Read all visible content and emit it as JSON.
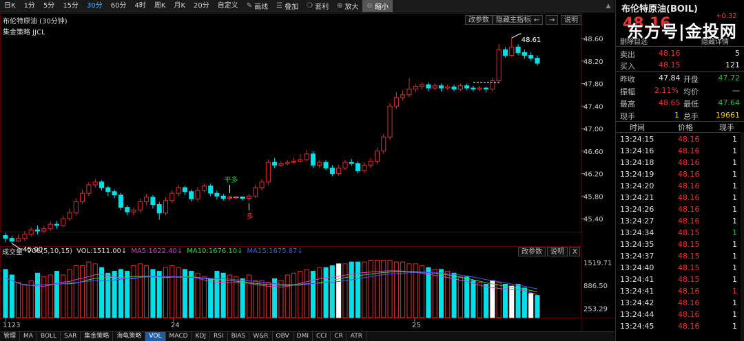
{
  "toolbar": {
    "timeframes": [
      {
        "label": "日K",
        "active": false
      },
      {
        "label": "1分",
        "active": false
      },
      {
        "label": "5分",
        "active": false
      },
      {
        "label": "15分",
        "active": false
      },
      {
        "label": "30分",
        "active": true
      },
      {
        "label": "60分",
        "active": false
      },
      {
        "label": "4时",
        "active": false
      },
      {
        "label": "周K",
        "active": false
      },
      {
        "label": "月K",
        "active": false
      },
      {
        "label": "20分",
        "active": false
      },
      {
        "label": "自定义",
        "active": false
      }
    ],
    "tools": [
      {
        "label": "画线",
        "icon": "pencil-icon",
        "glyph": "✎",
        "active": false
      },
      {
        "label": "叠加",
        "icon": "stack-icon",
        "glyph": "☰",
        "active": false
      },
      {
        "label": "套利",
        "icon": "money-bag-icon",
        "glyph": "❍",
        "active": false
      },
      {
        "label": "放大",
        "icon": "zoom-in-icon",
        "glyph": "⊕",
        "active": false
      },
      {
        "label": "缩小",
        "icon": "zoom-out-icon",
        "glyph": "⊖",
        "active": true
      }
    ],
    "scroll_up_icon": "▲"
  },
  "chart": {
    "title": "布伦特原油 (30分钟)",
    "strategy": "集金策略 JJCL",
    "buttons": {
      "params": "改参数",
      "hide": "隐藏主指标",
      "left": "←",
      "right": "→",
      "help": "说明"
    },
    "price_axis": [
      "48.60",
      "48.20",
      "47.80",
      "47.40",
      "47.00",
      "46.60",
      "46.20",
      "45.80",
      "45.40"
    ],
    "annotations": {
      "high_label": "48.61",
      "low_label": "45.00",
      "signal_flat": "平多",
      "signal_long": "多"
    },
    "x_axis": [
      "1123",
      "24",
      "25"
    ],
    "colors": {
      "up": "#e03030",
      "down": "#00e0e8",
      "ma5": "#e03cd6",
      "ma10": "#34d34a",
      "ma15": "#4a56ff"
    }
  },
  "volume": {
    "title": "成交量",
    "params": "VOL(5,10,15)",
    "vol": "VOL:1511.00↓",
    "ma5": "MA5:1622.40↓",
    "ma10": "MA10:1676.10↓",
    "ma15": "MA15:1675.87↓",
    "axis": [
      "1519.71",
      "886.50",
      "253.29"
    ],
    "buttons": {
      "params": "改参数",
      "help": "说明",
      "close": "X"
    }
  },
  "bottom_tabs": [
    {
      "label": "管理",
      "active": false
    },
    {
      "label": "MA",
      "active": false
    },
    {
      "label": "BOLL",
      "active": false
    },
    {
      "label": "SAR",
      "active": false
    },
    {
      "label": "集金策略",
      "active": false
    },
    {
      "label": "海龟策略",
      "active": false
    },
    {
      "label": "VOL",
      "active": true
    },
    {
      "label": "MACD",
      "active": false
    },
    {
      "label": "KDJ",
      "active": false
    },
    {
      "label": "RSI",
      "active": false
    },
    {
      "label": "BIAS",
      "active": false
    },
    {
      "label": "W&R",
      "active": false
    },
    {
      "label": "OBV",
      "active": false
    },
    {
      "label": "DMI",
      "active": false
    },
    {
      "label": "CCI",
      "active": false
    },
    {
      "label": "CR",
      "active": false
    },
    {
      "label": "ATR",
      "active": false
    }
  ],
  "panel": {
    "name": "布伦特原油(BOIL)",
    "big_price": "48.16",
    "change": "+0.32",
    "watermark": "东方号|金投网",
    "delete_watch": "删除自选",
    "hide_detail": "隐藏详情",
    "quotes": [
      {
        "label": "卖出",
        "value": "48.16",
        "extra": "5"
      },
      {
        "label": "买入",
        "value": "48.15",
        "extra": "121"
      }
    ],
    "stats": [
      {
        "l1": "昨收",
        "v1": "47.84",
        "l2": "开盘",
        "v2": "47.72"
      },
      {
        "l1": "振幅",
        "v1": "2.11%",
        "l2": "均价",
        "v2": "—"
      },
      {
        "l1": "最高",
        "v1": "48.65",
        "l2": "最低",
        "v2": "47.64"
      },
      {
        "l1": "现手",
        "v1": "1",
        "l2": "总手",
        "v2": "19661"
      }
    ],
    "tick_headers": {
      "time": "时间",
      "price": "价格",
      "vol": "现手"
    },
    "ticks": [
      {
        "time": "13:24:15",
        "price": "48.16",
        "vol": "1"
      },
      {
        "time": "13:24:16",
        "price": "48.16",
        "vol": "1"
      },
      {
        "time": "13:24:18",
        "price": "48.16",
        "vol": "1"
      },
      {
        "time": "13:24:19",
        "price": "48.16",
        "vol": "1"
      },
      {
        "time": "13:24:20",
        "price": "48.16",
        "vol": "1"
      },
      {
        "time": "13:24:21",
        "price": "48.16",
        "vol": "1"
      },
      {
        "time": "13:24:26",
        "price": "48.16",
        "vol": "1"
      },
      {
        "time": "13:24:27",
        "price": "48.16",
        "vol": "1"
      },
      {
        "time": "13:24:34",
        "price": "48.15",
        "vol": "1",
        "vcolor": "green"
      },
      {
        "time": "13:24:35",
        "price": "48.15",
        "vol": "1"
      },
      {
        "time": "13:24:37",
        "price": "48.15",
        "vol": "1"
      },
      {
        "time": "13:24:40",
        "price": "48.15",
        "vol": "1"
      },
      {
        "time": "13:24:41",
        "price": "48.15",
        "vol": "1"
      },
      {
        "time": "13:24:41",
        "price": "48.16",
        "vol": "1",
        "vcolor": "red"
      },
      {
        "time": "13:24:42",
        "price": "48.16",
        "vol": "1"
      },
      {
        "time": "13:24:44",
        "price": "48.16",
        "vol": "1"
      },
      {
        "time": "13:24:45",
        "price": "48.16",
        "vol": "1"
      }
    ]
  },
  "chart_data": {
    "type": "candlestick",
    "title": "布伦特原油 (30分钟)",
    "ylim": [
      45.0,
      48.7
    ],
    "candles": [
      [
        45.1,
        45.05,
        45.15,
        44.98
      ],
      [
        45.05,
        45.0,
        45.1,
        44.96
      ],
      [
        45.0,
        45.05,
        45.12,
        44.98
      ],
      [
        45.05,
        45.12,
        45.18,
        45.0
      ],
      [
        45.12,
        45.2,
        45.25,
        45.08
      ],
      [
        45.2,
        45.18,
        45.28,
        45.12
      ],
      [
        45.18,
        45.22,
        45.28,
        45.14
      ],
      [
        45.22,
        45.3,
        45.36,
        45.18
      ],
      [
        45.3,
        45.28,
        45.36,
        45.22
      ],
      [
        45.28,
        45.4,
        45.45,
        45.24
      ],
      [
        45.4,
        45.5,
        45.58,
        45.36
      ],
      [
        45.5,
        45.7,
        45.76,
        45.46
      ],
      [
        45.7,
        45.85,
        45.92,
        45.66
      ],
      [
        45.85,
        46.0,
        46.05,
        45.8
      ],
      [
        46.0,
        46.05,
        46.1,
        45.95
      ],
      [
        46.05,
        45.95,
        46.08,
        45.9
      ],
      [
        45.95,
        45.88,
        45.98,
        45.8
      ],
      [
        45.88,
        45.82,
        45.92,
        45.76
      ],
      [
        45.82,
        45.6,
        45.86,
        45.55
      ],
      [
        45.6,
        45.52,
        45.64,
        45.46
      ],
      [
        45.52,
        45.55,
        45.6,
        45.46
      ],
      [
        45.55,
        45.7,
        45.76,
        45.5
      ],
      [
        45.7,
        45.78,
        45.84,
        45.64
      ],
      [
        45.78,
        45.65,
        45.82,
        45.58
      ],
      [
        45.65,
        45.5,
        45.7,
        45.38
      ],
      [
        45.5,
        45.72,
        45.78,
        45.46
      ],
      [
        45.72,
        45.85,
        45.9,
        45.68
      ],
      [
        45.85,
        45.95,
        46.0,
        45.8
      ],
      [
        45.95,
        45.88,
        45.98,
        45.82
      ],
      [
        45.88,
        45.75,
        45.92,
        45.7
      ],
      [
        45.75,
        45.9,
        45.96,
        45.7
      ],
      [
        45.9,
        45.98,
        46.02,
        45.86
      ],
      [
        45.98,
        45.85,
        46.02,
        45.8
      ],
      [
        45.85,
        45.8,
        45.9,
        45.74
      ],
      [
        45.8,
        45.76,
        45.84,
        45.72
      ],
      [
        45.76,
        45.78,
        45.8,
        45.72
      ],
      [
        45.78,
        45.78,
        45.8,
        45.74
      ],
      [
        45.78,
        45.76,
        45.8,
        45.72
      ],
      [
        45.76,
        45.8,
        45.84,
        45.72
      ],
      [
        45.8,
        45.95,
        46.0,
        45.76
      ],
      [
        45.95,
        46.05,
        46.1,
        45.9
      ],
      [
        46.05,
        46.4,
        46.45,
        46.0
      ],
      [
        46.4,
        46.35,
        46.48,
        46.3
      ],
      [
        46.35,
        46.38,
        46.42,
        46.32
      ],
      [
        46.38,
        46.4,
        46.44,
        46.34
      ],
      [
        46.4,
        46.42,
        46.48,
        46.38
      ],
      [
        46.42,
        46.45,
        46.55,
        46.4
      ],
      [
        46.45,
        46.55,
        46.62,
        46.42
      ],
      [
        46.55,
        46.35,
        46.6,
        46.3
      ],
      [
        46.35,
        46.4,
        46.44,
        46.3
      ],
      [
        46.4,
        46.3,
        46.44,
        46.26
      ],
      [
        46.3,
        46.2,
        46.35,
        46.15
      ],
      [
        46.2,
        46.3,
        46.36,
        46.16
      ],
      [
        46.3,
        46.4,
        46.44,
        46.26
      ],
      [
        46.4,
        46.38,
        46.46,
        46.34
      ],
      [
        46.38,
        46.25,
        46.42,
        46.2
      ],
      [
        46.25,
        46.35,
        46.4,
        46.22
      ],
      [
        46.35,
        46.42,
        46.48,
        46.3
      ],
      [
        46.42,
        46.6,
        46.66,
        46.38
      ],
      [
        46.6,
        46.85,
        46.9,
        46.55
      ],
      [
        46.85,
        47.4,
        47.45,
        46.8
      ],
      [
        47.4,
        47.55,
        47.65,
        47.35
      ],
      [
        47.55,
        47.6,
        47.68,
        47.5
      ],
      [
        47.6,
        47.7,
        47.9,
        47.56
      ],
      [
        47.7,
        47.75,
        47.8,
        47.64
      ],
      [
        47.75,
        47.78,
        47.82,
        47.7
      ],
      [
        47.78,
        47.72,
        47.82,
        47.66
      ],
      [
        47.72,
        47.76,
        47.8,
        47.68
      ],
      [
        47.76,
        47.72,
        47.8,
        47.66
      ],
      [
        47.72,
        47.74,
        47.78,
        47.68
      ],
      [
        47.74,
        47.7,
        47.78,
        47.66
      ],
      [
        47.7,
        47.76,
        47.8,
        47.66
      ],
      [
        47.76,
        47.72,
        47.8,
        47.68
      ],
      [
        47.72,
        47.7,
        47.76,
        47.66
      ],
      [
        47.7,
        47.72,
        47.76,
        47.66
      ],
      [
        47.72,
        47.7,
        47.74,
        47.64
      ],
      [
        47.7,
        47.85,
        47.9,
        47.66
      ],
      [
        47.85,
        48.4,
        48.5,
        47.8
      ],
      [
        48.4,
        48.3,
        48.45,
        48.26
      ],
      [
        48.3,
        48.45,
        48.61,
        48.28
      ],
      [
        48.45,
        48.35,
        48.5,
        48.3
      ],
      [
        48.35,
        48.3,
        48.4,
        48.24
      ],
      [
        48.3,
        48.25,
        48.36,
        48.2
      ],
      [
        48.25,
        48.16,
        48.3,
        48.12
      ]
    ],
    "volume": {
      "ylim": [
        0,
        1650
      ],
      "values": [
        1300,
        1150,
        950,
        900,
        1000,
        1200,
        1100,
        1150,
        1250,
        1150,
        1300,
        1400,
        1400,
        1500,
        1450,
        1350,
        1200,
        1250,
        1300,
        1250,
        1400,
        1450,
        1400,
        1300,
        1250,
        1350,
        1400,
        1350,
        1300,
        1250,
        1200,
        1100,
        1050,
        1250,
        1200,
        1150,
        1100,
        1050,
        1150,
        1000,
        1000,
        950,
        1050,
        1000,
        1150,
        1200,
        1250,
        1300,
        1250,
        1350,
        1350,
        1400,
        1450,
        1450,
        1500,
        1500,
        1500,
        1550,
        1550,
        1550,
        1550,
        1500,
        1500,
        1450,
        1450,
        1400,
        1350,
        1300,
        1300,
        1250,
        1200,
        1100,
        1100,
        1000,
        950,
        900,
        1000,
        950,
        900,
        850,
        900,
        800,
        650,
        600
      ],
      "series": [
        {
          "name": "MA5",
          "value": 1622.4
        },
        {
          "name": "MA10",
          "value": 1676.1
        },
        {
          "name": "MA15",
          "value": 1675.87
        }
      ]
    }
  }
}
